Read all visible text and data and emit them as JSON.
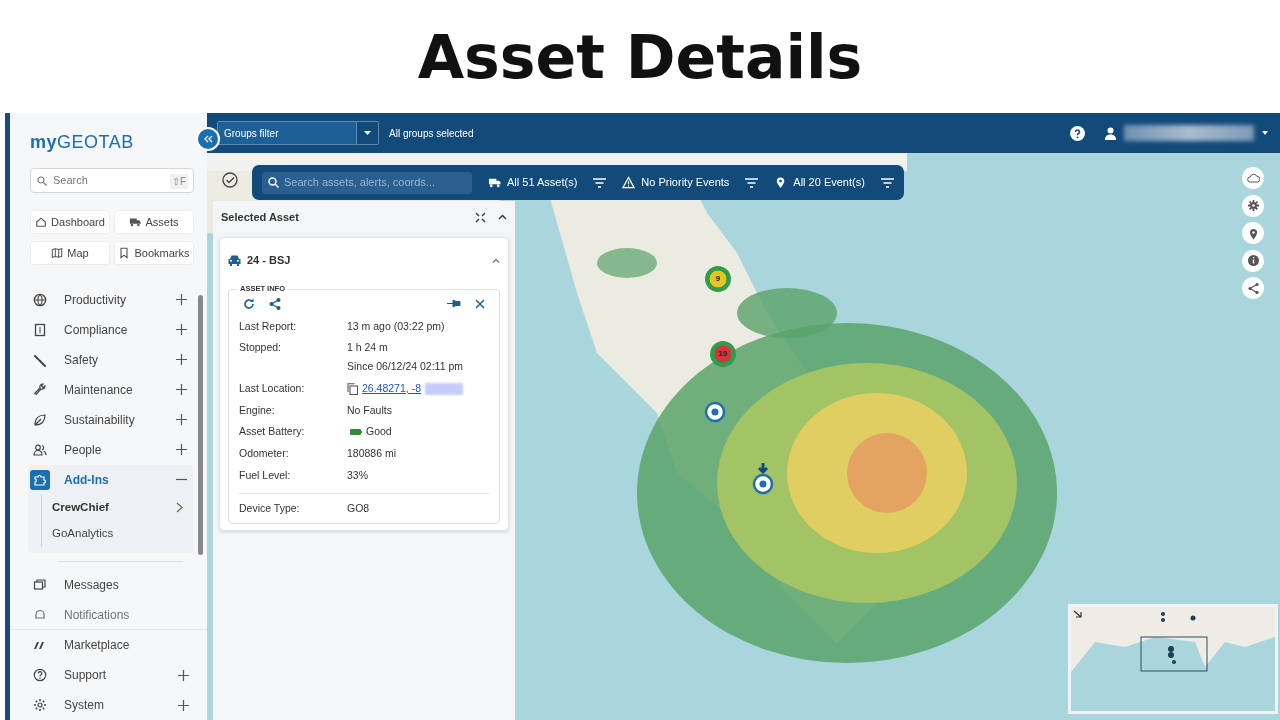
{
  "heading": "Asset Details",
  "sidebar": {
    "logo_prefix": "my",
    "logo_main": "GEOTAB",
    "search": {
      "placeholder": "Search",
      "shortcut": "⇧F"
    },
    "quick_links": [
      {
        "label": "Dashboard"
      },
      {
        "label": "Assets"
      },
      {
        "label": "Map"
      },
      {
        "label": "Bookmarks"
      }
    ],
    "nav_items": [
      {
        "label": "Productivity",
        "kind": "group",
        "expanded": false,
        "selected": false
      },
      {
        "label": "Compliance",
        "kind": "group",
        "expanded": false,
        "selected": false
      },
      {
        "label": "Safety",
        "kind": "group",
        "expanded": false,
        "selected": false
      },
      {
        "label": "Maintenance",
        "kind": "group",
        "expanded": false,
        "selected": false
      },
      {
        "label": "Sustainability",
        "kind": "group",
        "expanded": false,
        "selected": false
      },
      {
        "label": "People",
        "kind": "group",
        "expanded": false,
        "selected": false
      },
      {
        "label": "Add-Ins",
        "kind": "group",
        "expanded": true,
        "selected": true,
        "children": [
          {
            "label": "CrewChief",
            "kind": "submenu",
            "selected": true
          },
          {
            "label": "GoAnalytics",
            "kind": "link",
            "selected": false
          }
        ]
      },
      {
        "label": "Messages",
        "kind": "link",
        "expanded": false,
        "selected": false
      },
      {
        "label": "Notifications",
        "kind": "link",
        "expanded": false,
        "selected": false
      }
    ],
    "footer_items": [
      {
        "label": "Marketplace",
        "kind": "link"
      },
      {
        "label": "Support",
        "kind": "group"
      },
      {
        "label": "System",
        "kind": "group"
      }
    ]
  },
  "top_bar": {
    "groups_filter": "Groups filter",
    "groups_status": "All groups selected"
  },
  "map_toolbar": {
    "search": {
      "placeholder": "Search assets, alerts, coords..."
    },
    "filters": [
      {
        "label": "All 51 Asset(s)"
      },
      {
        "label": "No Priority Events"
      },
      {
        "label": "All 20 Event(s)"
      }
    ]
  },
  "selected_asset": {
    "title": "Selected Asset",
    "asset": "24 - BSJ",
    "section": "ASSET INFO",
    "rows": [
      {
        "label": "Last Report:",
        "kind": "text",
        "value": "13 m ago (03:22 pm)"
      },
      {
        "label": "Stopped:",
        "kind": "text",
        "value": "1 h 24 m",
        "note": "Since 06/12/24 02:11 pm"
      },
      {
        "label": "Last Location:",
        "kind": "link",
        "value": "26.48271, -8"
      },
      {
        "label": "Engine:",
        "kind": "text",
        "value": "No Faults"
      },
      {
        "label": "Asset Battery:",
        "kind": "battery",
        "value": "Good"
      },
      {
        "label": "Odometer:",
        "kind": "text",
        "value": "180886 mi"
      },
      {
        "label": "Fuel Level:",
        "kind": "text",
        "value": "33%"
      },
      {
        "label": "Device Type:",
        "kind": "text",
        "value": "GO8",
        "separated": true
      }
    ]
  },
  "map": {
    "clusters": [
      {
        "count": "9",
        "color": "#e8c51c"
      },
      {
        "count": "19",
        "color": "#d8323c"
      }
    ],
    "pins": [
      {
        "kind": "asset"
      },
      {
        "kind": "selected"
      }
    ]
  }
}
